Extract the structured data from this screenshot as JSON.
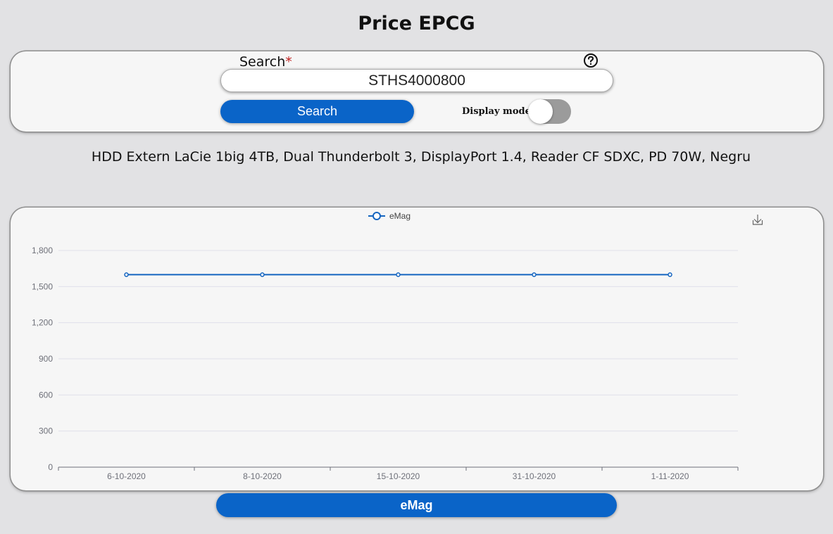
{
  "header": {
    "title": "Price EPCG"
  },
  "search": {
    "label": "Search",
    "required_mark": "*",
    "value": "STHS4000800",
    "button_label": "Search",
    "display_mode_label": "Display mode",
    "display_mode_on": false
  },
  "product": {
    "name": "HDD Extern LaCie 1big 4TB, Dual Thunderbolt 3, DisplayPort 1.4, Reader CF SDXC, PD 70W, Negru"
  },
  "icons": {
    "help": "help-circle-icon",
    "download": "download-icon"
  },
  "colors": {
    "accent": "#0a64c8",
    "series": "#1565c0",
    "required": "#c0201f"
  },
  "chart_data": {
    "type": "line",
    "categories": [
      "6-10-2020",
      "8-10-2020",
      "15-10-2020",
      "31-10-2020",
      "1-11-2020"
    ],
    "series": [
      {
        "name": "eMag",
        "values": [
          1599,
          1599,
          1599,
          1599,
          1599
        ]
      }
    ],
    "ylim": [
      0,
      1800
    ],
    "yticks": [
      0,
      300,
      600,
      900,
      1200,
      1500,
      1800
    ],
    "ytick_labels": [
      "0",
      "300",
      "600",
      "900",
      "1,200",
      "1,500",
      "1,800"
    ],
    "grid": true,
    "legend": "top-center"
  },
  "shops": [
    {
      "label": "eMag"
    }
  ]
}
